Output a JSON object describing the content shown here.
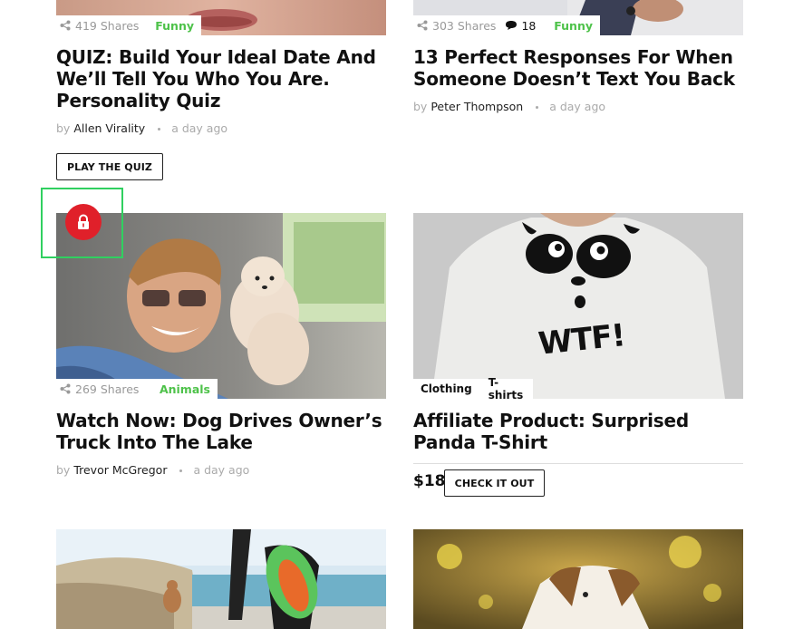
{
  "colors": {
    "accent_green": "#4ec24a",
    "lock_red": "#e0202a",
    "highlight_green": "#30d060"
  },
  "posts": [
    {
      "shares": "419",
      "shares_label": "Shares",
      "category": "Funny",
      "title": "QUIZ: Build Your Ideal Date And We’ll Tell You Who You Are. Personality Quiz",
      "by": "by",
      "author": "Allen Virality",
      "time": "a day ago",
      "button": "PLAY THE QUIZ"
    },
    {
      "shares": "303",
      "shares_label": "Shares",
      "comments": "18",
      "category": "Funny",
      "title": "13 Perfect Responses For When Someone Doesn’t Text You Back",
      "by": "by",
      "author": "Peter Thompson",
      "time": "a day ago"
    },
    {
      "shares": "269",
      "shares_label": "Shares",
      "category": "Animals",
      "title": "Watch Now: Dog Drives Owner’s Truck Into The Lake",
      "by": "by",
      "author": "Trevor McGregor",
      "time": "a day ago",
      "badge_icon": "lock-icon"
    },
    {
      "tags": [
        "Clothing",
        "T-shirts"
      ],
      "title": "Affiliate Product: Surprised Panda T-Shirt",
      "price": "$18",
      "button": "CHECK IT OUT",
      "shirt_text": "WTF!"
    }
  ]
}
